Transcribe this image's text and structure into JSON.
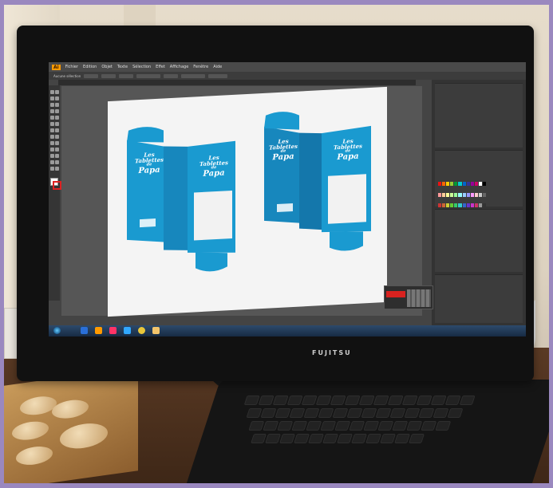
{
  "scene": {
    "monitor_brand": "FUJITSU",
    "colors": {
      "wall": "#e3d8c6",
      "desk": "#4a2f1c",
      "monitor_bezel": "#111111",
      "packaging_blue": "#1a9ad0",
      "illustrator_orange": "#ff9a00"
    }
  },
  "app": {
    "logo": "Ai",
    "menu": [
      "Fichier",
      "Edition",
      "Objet",
      "Texte",
      "Sélection",
      "Effet",
      "Affichage",
      "Fenêtre",
      "Aide"
    ],
    "options_bar_label": "Aucune sélection"
  },
  "artwork": {
    "box_title_line1": "Les Tablettes",
    "box_title_line2": "de",
    "box_title_line3": "Papa"
  },
  "icons": [
    "start-button-icon",
    "explorer-icon",
    "illustrator-taskbar-icon",
    "indesign-taskbar-icon",
    "photoshop-taskbar-icon",
    "chrome-taskbar-icon",
    "folder-taskbar-icon"
  ]
}
